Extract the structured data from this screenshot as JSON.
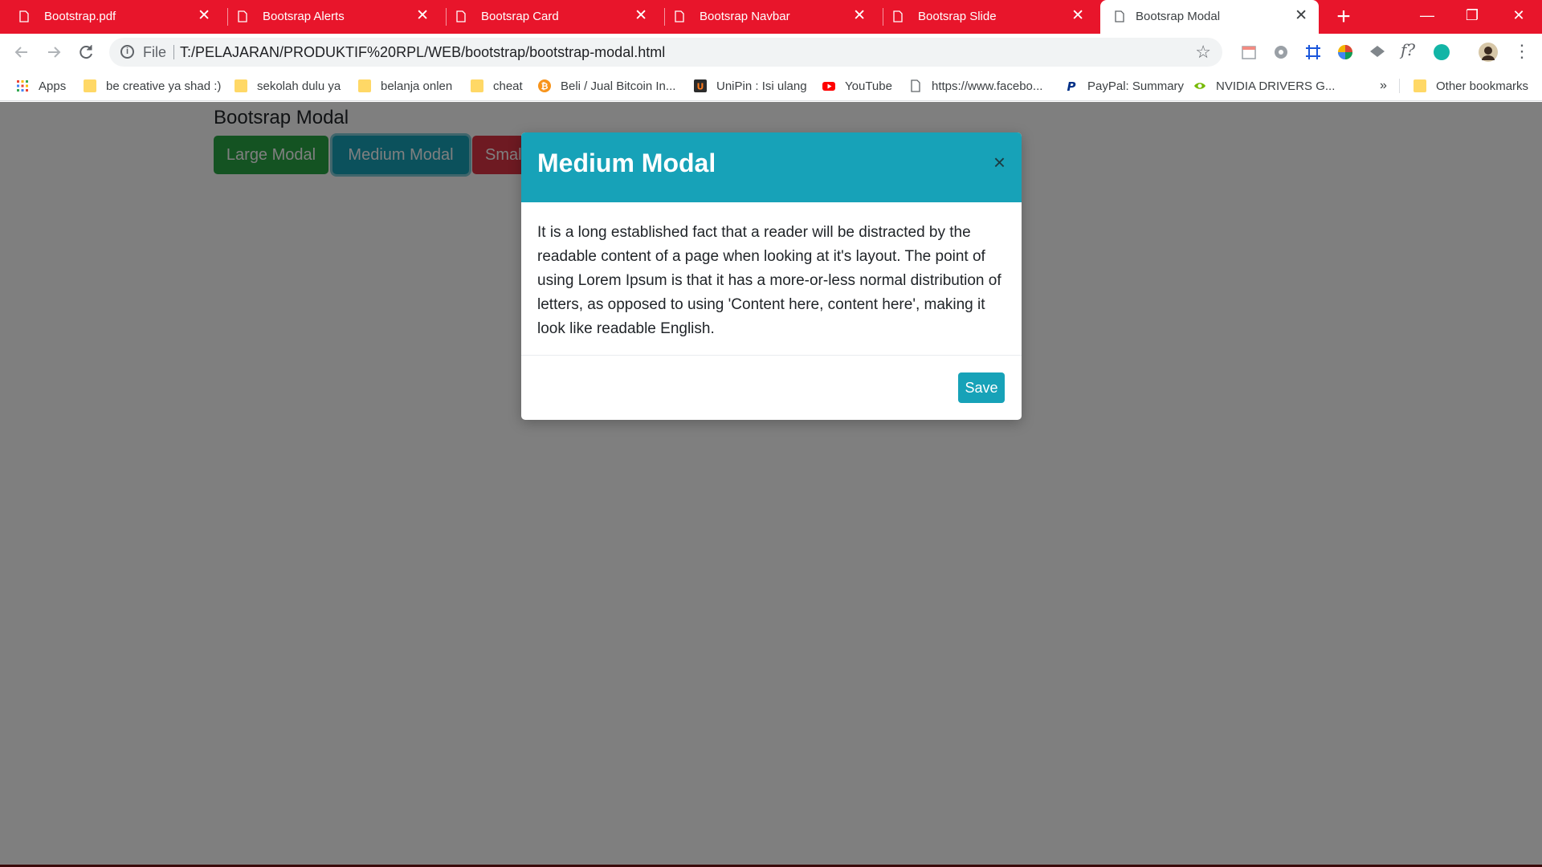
{
  "browser": {
    "tabs": [
      {
        "title": "Bootstrap.pdf",
        "active": false
      },
      {
        "title": "Bootsrap Alerts",
        "active": false
      },
      {
        "title": "Bootsrap Card",
        "active": false
      },
      {
        "title": "Bootsrap Navbar",
        "active": false
      },
      {
        "title": "Bootsrap Slide",
        "active": false
      },
      {
        "title": "Bootsrap Modal",
        "active": true
      }
    ],
    "close_glyph": "✕",
    "new_tab_glyph": "+",
    "window_controls": {
      "minimize": "—",
      "maximize": "❐",
      "close": "✕"
    },
    "toolbar": {
      "scheme_label": "File",
      "url": "T:/PELAJARAN/PRODUKTIF%20RPL/WEB/bootstrap/bootstrap-modal.html"
    },
    "bookmarks": [
      {
        "label": "Apps",
        "icon": "apps-grid-icon"
      },
      {
        "label": "be creative ya shad :)",
        "icon": "folder-icon"
      },
      {
        "label": "sekolah dulu ya",
        "icon": "folder-icon"
      },
      {
        "label": "belanja onlen",
        "icon": "folder-icon"
      },
      {
        "label": "cheat",
        "icon": "folder-icon"
      },
      {
        "label": "Beli / Jual Bitcoin In...",
        "icon": "bitcoin-icon"
      },
      {
        "label": "UniPin : Isi ulang",
        "icon": "unipin-icon"
      },
      {
        "label": "YouTube",
        "icon": "youtube-icon"
      },
      {
        "label": "https://www.facebo...",
        "icon": "page-icon"
      },
      {
        "label": "PayPal: Summary",
        "icon": "paypal-icon"
      },
      {
        "label": "NVIDIA DRIVERS G...",
        "icon": "nvidia-icon"
      }
    ],
    "bookmarks_overflow": "»",
    "other_bookmarks": "Other bookmarks"
  },
  "page": {
    "title": "Bootsrap Modal",
    "buttons": {
      "large": "Large Modal",
      "medium": "Medium Modal",
      "small": "Smal"
    }
  },
  "modal": {
    "title": "Medium Modal",
    "close_glyph": "×",
    "body": "It is a long established fact that a reader will be distracted by the readable content of a page when looking at it's layout. The point of using Lorem Ipsum is that it has a more-or-less normal distribution of letters, as opposed to using 'Content here, content here', making it look like readable English.",
    "save_label": "Save"
  },
  "colors": {
    "tabstrip": "#e8152b",
    "info": "#17a2b8",
    "success": "#28a745",
    "danger": "#dc3545"
  }
}
